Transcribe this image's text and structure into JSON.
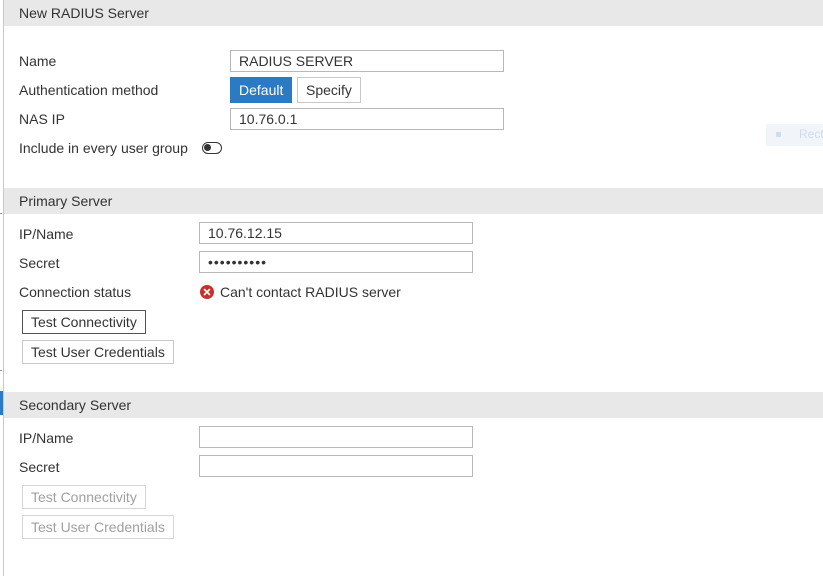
{
  "title": "New RADIUS Server",
  "general": {
    "name_label": "Name",
    "name_value": "RADIUS SERVER",
    "auth_method_label": "Authentication method",
    "auth_options": [
      "Default",
      "Specify"
    ],
    "auth_selected": "Default",
    "nas_ip_label": "NAS IP",
    "nas_ip_value": "10.76.0.1",
    "include_label": "Include in every user group",
    "include_enabled": false
  },
  "primary": {
    "header": "Primary Server",
    "ip_label": "IP/Name",
    "ip_value": "10.76.12.15",
    "secret_label": "Secret",
    "secret_value": "••••••••••",
    "connection_label": "Connection status",
    "connection_status": "Can't contact RADIUS server",
    "status_color": "#c9302c",
    "test_connectivity": "Test Connectivity",
    "test_credentials": "Test User Credentials"
  },
  "secondary": {
    "header": "Secondary Server",
    "ip_label": "IP/Name",
    "ip_value": "",
    "secret_label": "Secret",
    "secret_value": "",
    "test_connectivity": "Test Connectivity",
    "test_credentials": "Test User Credentials"
  },
  "ghost_tooltip": {
    "text": "Rect"
  },
  "colors": {
    "accent": "#2b7ac4",
    "header_bg": "#e8e8e8",
    "error": "#c9302c"
  }
}
